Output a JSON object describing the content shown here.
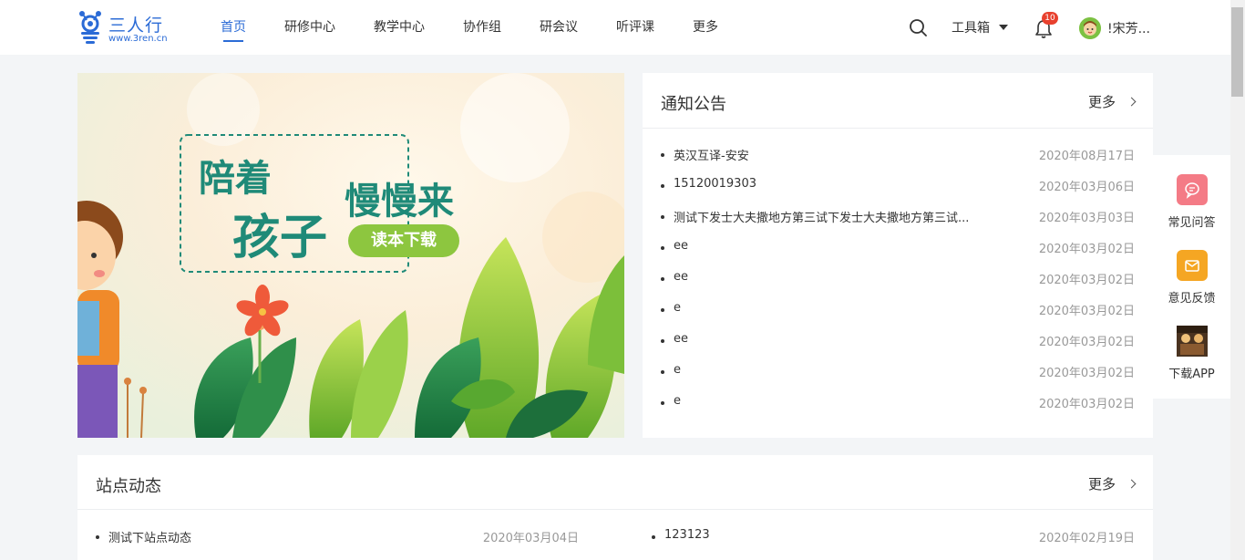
{
  "header": {
    "logo_text": "三人行",
    "logo_url": "www.3ren.cn",
    "nav": [
      {
        "label": "首页",
        "active": true
      },
      {
        "label": "研修中心"
      },
      {
        "label": "教学中心"
      },
      {
        "label": "协作组"
      },
      {
        "label": "研会议"
      },
      {
        "label": "听评课"
      },
      {
        "label": "更多"
      }
    ],
    "toolbox_label": "工具箱",
    "notification_count": "10",
    "username": "!宋芳..."
  },
  "banner": {
    "line1": "陪着",
    "line2": "孩子",
    "line3": "慢慢来",
    "button": "读本下载"
  },
  "notice": {
    "title": "通知公告",
    "more": "更多",
    "items": [
      {
        "title": "英汉互译-安安",
        "date": "2020年08月17日"
      },
      {
        "title": "15120019303",
        "date": "2020年03月06日"
      },
      {
        "title": "测试下发士大夫撒地方第三试下发士大夫撒地方第三试...",
        "date": "2020年03月03日"
      },
      {
        "title": "ee",
        "date": "2020年03月02日"
      },
      {
        "title": "ee",
        "date": "2020年03月02日"
      },
      {
        "title": "e",
        "date": "2020年03月02日"
      },
      {
        "title": "ee",
        "date": "2020年03月02日"
      },
      {
        "title": "e",
        "date": "2020年03月02日"
      },
      {
        "title": "e",
        "date": "2020年03月02日"
      }
    ]
  },
  "side": {
    "faq": "常见问答",
    "feedback": "意见反馈",
    "app": "下载APP"
  },
  "station": {
    "title": "站点动态",
    "more": "更多",
    "items": [
      {
        "title": "测试下站点动态",
        "date": "2020年03月04日"
      },
      {
        "title": "123123",
        "date": "2020年02月19日"
      }
    ]
  },
  "colors": {
    "accent": "#2b6bd6",
    "faq_icon": "#f47b86",
    "feedback_icon": "#f5a623",
    "badge": "#e8412e"
  }
}
